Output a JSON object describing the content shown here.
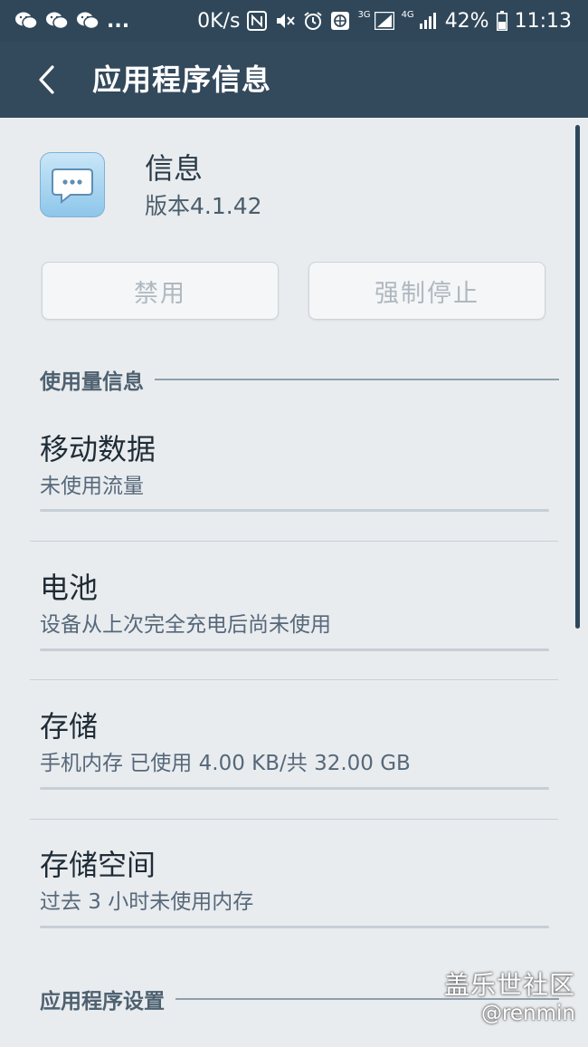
{
  "status_bar": {
    "network_speed": "0K/s",
    "more_indicator": "...",
    "badge_3g": "3G",
    "badge_4g": "4G",
    "battery_percent": "42%",
    "time": "11:13",
    "icons": [
      "wechat-icon",
      "wechat-icon",
      "wechat-icon",
      "nfc-icon",
      "mute-icon",
      "alarm-icon",
      "vpn-icon",
      "signal-icon",
      "signal-icon",
      "battery-icon"
    ]
  },
  "app_bar": {
    "title": "应用程序信息"
  },
  "app": {
    "name": "信息",
    "version": "版本4.1.42",
    "icon": "message-bubble-icon"
  },
  "actions": {
    "disable_label": "禁用",
    "force_stop_label": "强制停止"
  },
  "sections": {
    "usage_header": "使用量信息",
    "app_settings_header": "应用程序设置"
  },
  "items": [
    {
      "title": "移动数据",
      "subtitle": "未使用流量"
    },
    {
      "title": "电池",
      "subtitle": "设备从上次完全充电后尚未使用"
    },
    {
      "title": "存储",
      "subtitle": "手机内存 已使用 4.00 KB/共 32.00 GB"
    },
    {
      "title": "存储空间",
      "subtitle": "过去 3 小时未使用内存"
    }
  ],
  "watermark": {
    "title": "盖乐世社区",
    "user": "@renmin"
  },
  "colors": {
    "header_bg": "#33495c",
    "status_bg": "#2f4759",
    "page_bg": "#e9ecef"
  }
}
